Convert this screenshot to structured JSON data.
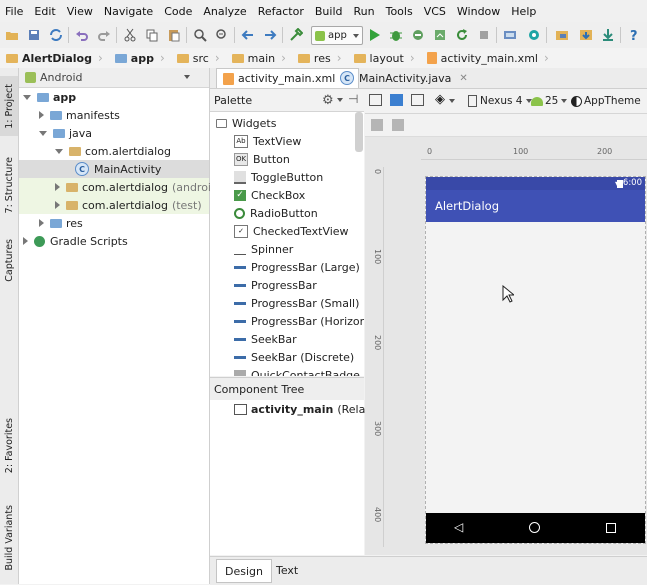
{
  "menu": [
    "File",
    "Edit",
    "View",
    "Navigate",
    "Code",
    "Analyze",
    "Refactor",
    "Build",
    "Run",
    "Tools",
    "VCS",
    "Window",
    "Help"
  ],
  "toolbar": {
    "run_config": "app"
  },
  "breadcrumb": [
    "AlertDialog",
    "app",
    "src",
    "main",
    "res",
    "layout",
    "activity_main.xml"
  ],
  "left_strip": [
    "1: Project",
    "7: Structure",
    "Captures",
    "2: Favorites",
    "Build Variants"
  ],
  "project": {
    "view_selector": "Android",
    "tree": [
      {
        "label": "app",
        "extra": ""
      },
      {
        "label": "manifests",
        "extra": ""
      },
      {
        "label": "java",
        "extra": ""
      },
      {
        "label": "com.alertdialog",
        "extra": ""
      },
      {
        "label": "MainActivity",
        "extra": ""
      },
      {
        "label": "com.alertdialog",
        "extra": "(androidT"
      },
      {
        "label": "com.alertdialog",
        "extra": "(test)"
      },
      {
        "label": "res",
        "extra": ""
      },
      {
        "label": "Gradle Scripts",
        "extra": ""
      }
    ]
  },
  "editor_tabs": [
    "activity_main.xml",
    "MainActivity.java"
  ],
  "palette": {
    "title": "Palette",
    "group": "Widgets",
    "items": [
      "TextView",
      "Button",
      "ToggleButton",
      "CheckBox",
      "RadioButton",
      "CheckedTextView",
      "Spinner",
      "ProgressBar (Large)",
      "ProgressBar",
      "ProgressBar (Small)",
      "ProgressBar (Horizontal)",
      "SeekBar",
      "SeekBar (Discrete)",
      "QuickContactBadge"
    ],
    "icon_text": {
      "textview": "Ab",
      "button": "OK"
    }
  },
  "component_tree": {
    "title": "Component Tree",
    "root_label": "activity_main",
    "root_type": "(RelativeLa"
  },
  "designer": {
    "device": "Nexus 4",
    "api": "25",
    "theme": "AppTheme",
    "ruler_h": [
      "0",
      "100",
      "200"
    ],
    "ruler_v": [
      "0",
      "100",
      "200",
      "300",
      "400"
    ]
  },
  "phone": {
    "time": "6:00",
    "app_title": "AlertDialog",
    "primary_color": "#3f51b5",
    "status_color": "#3949a8"
  },
  "bottom_tabs": [
    "Design",
    "Text"
  ]
}
